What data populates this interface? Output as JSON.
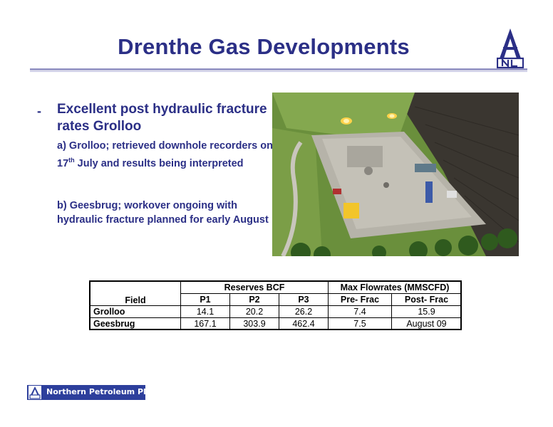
{
  "header": {
    "title": "Drenthe Gas Developments"
  },
  "bullet": {
    "dash": "-",
    "headline": "Excellent post hydraulic fracture rates Grolloo",
    "items": [
      {
        "pre": "a) Grolloo; retrieved downhole recorders on 17",
        "sup": "th",
        "post": " July and results being interpreted"
      },
      {
        "pre": "b) Geesbrug; workover ongoing with hydraulic fracture planned for early August",
        "sup": "",
        "post": ""
      }
    ]
  },
  "table": {
    "field_header": "Field",
    "group_reserves": "Reserves BCF",
    "group_flow": "Max Flowrates (MMSCFD)",
    "col_p1": "P1",
    "col_p2": "P2",
    "col_p3": "P3",
    "col_pre": "Pre- Frac",
    "col_post": "Post- Frac",
    "rows": [
      {
        "field": "Grolloo",
        "p1": "14.1",
        "p2": "20.2",
        "p3": "26.2",
        "pre": "7.4",
        "post": "15.9"
      },
      {
        "field": "Geesbrug",
        "p1": "167.1",
        "p2": "303.9",
        "p3": "462.4",
        "pre": "7.5",
        "post": "August 09"
      }
    ]
  },
  "footer": {
    "company": "Northern Petroleum Plc"
  },
  "colors": {
    "title": "#2b2f86",
    "footer_bg": "#2d3f9c"
  },
  "icons": {
    "top_logo": "derrick-logo-icon",
    "footer_logo": "derrick-logo-icon"
  }
}
